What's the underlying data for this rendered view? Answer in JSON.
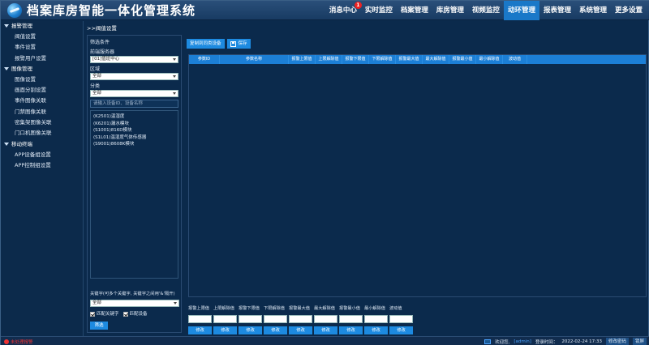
{
  "app": {
    "title": "档案库房智能一体化管理系统"
  },
  "nav": [
    {
      "label": "消息中心",
      "badge": "1"
    },
    {
      "label": "实时监控"
    },
    {
      "label": "档案管理"
    },
    {
      "label": "库房管理"
    },
    {
      "label": "视频监控"
    },
    {
      "label": "动环管理",
      "active": true
    },
    {
      "label": "报表管理"
    },
    {
      "label": "系统管理"
    },
    {
      "label": "更多设置"
    }
  ],
  "sidebar": {
    "groups": [
      {
        "label": "报警管理",
        "items": [
          "阀值设置",
          "事件设置",
          "报警用户设置"
        ]
      },
      {
        "label": "图像管理",
        "items": [
          "图像设置",
          "画面分割设置",
          "事件图像关联",
          "门禁图像关联",
          "密集架图像关联",
          "门口机图像关联"
        ]
      },
      {
        "label": "移动终端",
        "items": [
          "APP设备组设置",
          "APP控制组设置"
        ]
      }
    ]
  },
  "breadcrumb": ">>阀值设置",
  "filter": {
    "legend": "筛选条件",
    "server_label": "前端服务器",
    "server_value": "[01]值班中心",
    "area_label": "区域",
    "area_value": "全部",
    "category_label": "分类",
    "category_value": "全部",
    "search_placeholder": "请输入设备ID、设备名称",
    "devices": [
      "(K2501)温湿度",
      "(K6201)漏水模块",
      "(S1001)816D模块",
      "(S1L01)温湿度气体传感器",
      "(S9001)8608K模块"
    ],
    "keyword_label": "关键字(可多个关键字, 关键字之间用'&'隔开)",
    "keyword_value": "全部",
    "match_keyword": "匹配关键字",
    "match_device": "匹配设备",
    "filter_button": "筛选"
  },
  "toolbar": {
    "copy_button": "复制到同类设备",
    "save_button": "保存"
  },
  "table": {
    "columns": [
      "参数ID",
      "参数名称",
      "报警上限值",
      "上限解除值",
      "报警下限值",
      "下限解除值",
      "报警最大值",
      "最大解除值",
      "报警最小值",
      "最小解除值",
      "波动值"
    ],
    "rows": []
  },
  "editor": {
    "labels": [
      "报警上限值",
      "上限解除值",
      "报警下限值",
      "下限解除值",
      "报警最大值",
      "最大解除值",
      "报警最小值",
      "最小解除值",
      "波动值"
    ],
    "button_label": "修改"
  },
  "status": {
    "alarm_text": "未处理报警",
    "welcome": "欢迎您,",
    "user": "[admin]",
    "login_label": "登录时间：",
    "login_time": "2022-02-24 17:33",
    "change_password": "修改密码",
    "logout": "锁屏"
  },
  "colors": {
    "accent": "#1d8ae0",
    "header": "#1f4670",
    "background": "#0b2a4c",
    "alarm": "#e33333"
  }
}
